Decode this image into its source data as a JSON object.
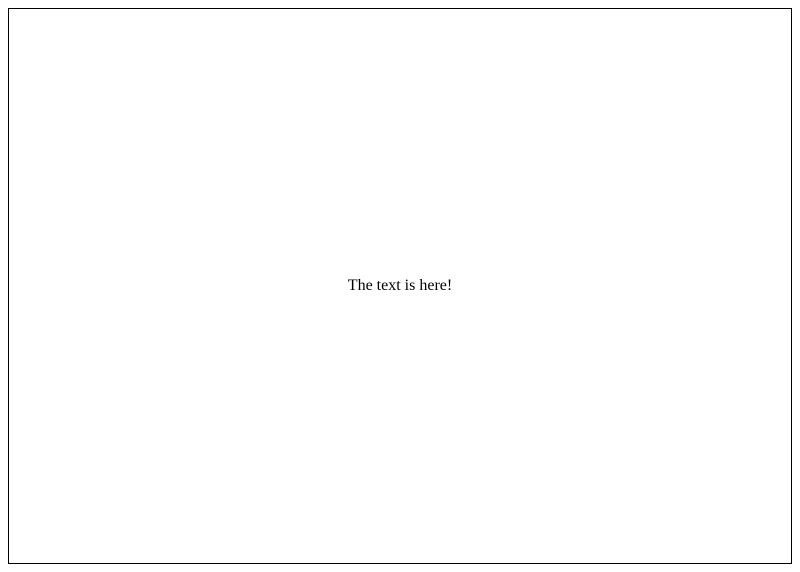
{
  "main": {
    "message": "The text is here!"
  }
}
